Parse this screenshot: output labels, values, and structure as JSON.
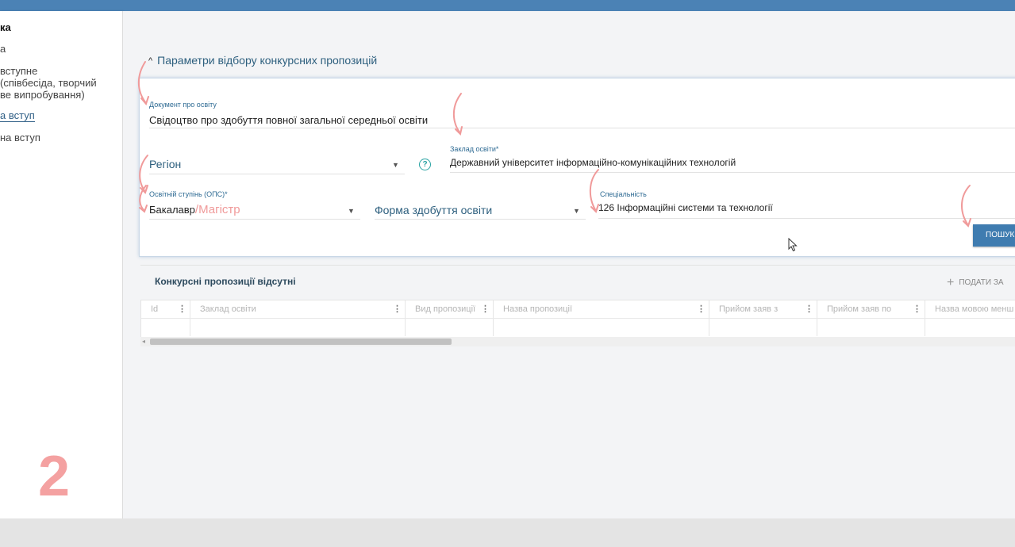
{
  "colors": {
    "accent": "#4b82b5",
    "link": "#2d5f7e",
    "annotation": "#f09a9a",
    "button": "#3f7cb0"
  },
  "sidebar": {
    "items": [
      {
        "label": "ка"
      },
      {
        "label": "а"
      },
      {
        "label": "вступне"
      },
      {
        "label": "(співбесіда, творчий"
      },
      {
        "label": "ве випробування)"
      },
      {
        "label": "а вступ"
      },
      {
        "label": "на вступ"
      }
    ],
    "step_number": "2"
  },
  "filters": {
    "section_title": "Параметри відбору конкурсних пропозицій",
    "doc": {
      "label": "Документ про освіту",
      "value": "Свідоцтво про здобуття повної загальної середньої освіти"
    },
    "region": {
      "placeholder": "Регіон",
      "icon": "chevron-down-icon"
    },
    "help_icon": "?",
    "institution": {
      "label": "Заклад освіти*",
      "value": "Державний університет інформаційно-комунікаційних технологій"
    },
    "degree": {
      "label": "Освітній ступінь (ОПС)*",
      "value": "Бакалавр",
      "annotation": "/Магістр"
    },
    "study_form": {
      "placeholder": "Форма здобуття освіти"
    },
    "specialty": {
      "label": "Спеціальність",
      "value": "126 Інформаційні системи та технології"
    },
    "search_button": "ПОШУК"
  },
  "results": {
    "title": "Конкурсні пропозиції відсутні",
    "add_label": "ПОДАТИ ЗА",
    "columns": [
      "Id",
      "Заклад освіти",
      "Вид пропозиції",
      "Назва пропозиції",
      "Прийом заяв з",
      "Прийом заяв по",
      "Назва мовою менш"
    ]
  }
}
